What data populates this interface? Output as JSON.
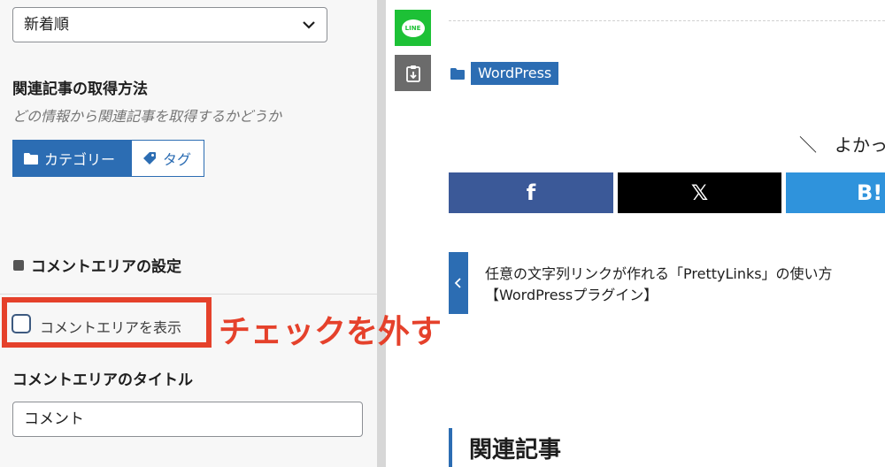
{
  "settings": {
    "sort_select": {
      "value": "新着順"
    },
    "related_fetch": {
      "label": "関連記事の取得方法",
      "description": "どの情報から関連記事を取得するかどうか",
      "options": [
        {
          "label": "カテゴリー",
          "icon": "folder-icon",
          "selected": true
        },
        {
          "label": "タグ",
          "icon": "tag-icon",
          "selected": false
        }
      ]
    },
    "comment_section": {
      "header": "コメントエリアの設定",
      "checkbox_label": "コメントエリアを表示",
      "checkbox_checked": false,
      "title_label": "コメントエリアのタイトル",
      "title_value": "コメント"
    }
  },
  "annotation": {
    "text": "チェックを外す",
    "color": "#e5412b"
  },
  "preview": {
    "share_side": [
      {
        "icon": "line-icon",
        "text": "LINE",
        "color": "#1dc136"
      },
      {
        "icon": "save-icon",
        "color": "#6b6b6b"
      }
    ],
    "category_chip": "WordPress",
    "share_heading": "＼　よかっ",
    "sns_buttons": [
      {
        "label": "f",
        "color": "#3b5998"
      },
      {
        "label": "𝕏",
        "color": "#000000"
      },
      {
        "label": "B!",
        "color": "#2f93dc"
      }
    ],
    "prev_post": {
      "title_line1": "任意の文字列リンクが作れる「PrettyLinks」の使い方",
      "title_line2": "【WordPressプラグイン】"
    },
    "related_heading": "関連記事"
  },
  "colors": {
    "accent": "#2c6db3",
    "annotation_red": "#e5412b"
  }
}
